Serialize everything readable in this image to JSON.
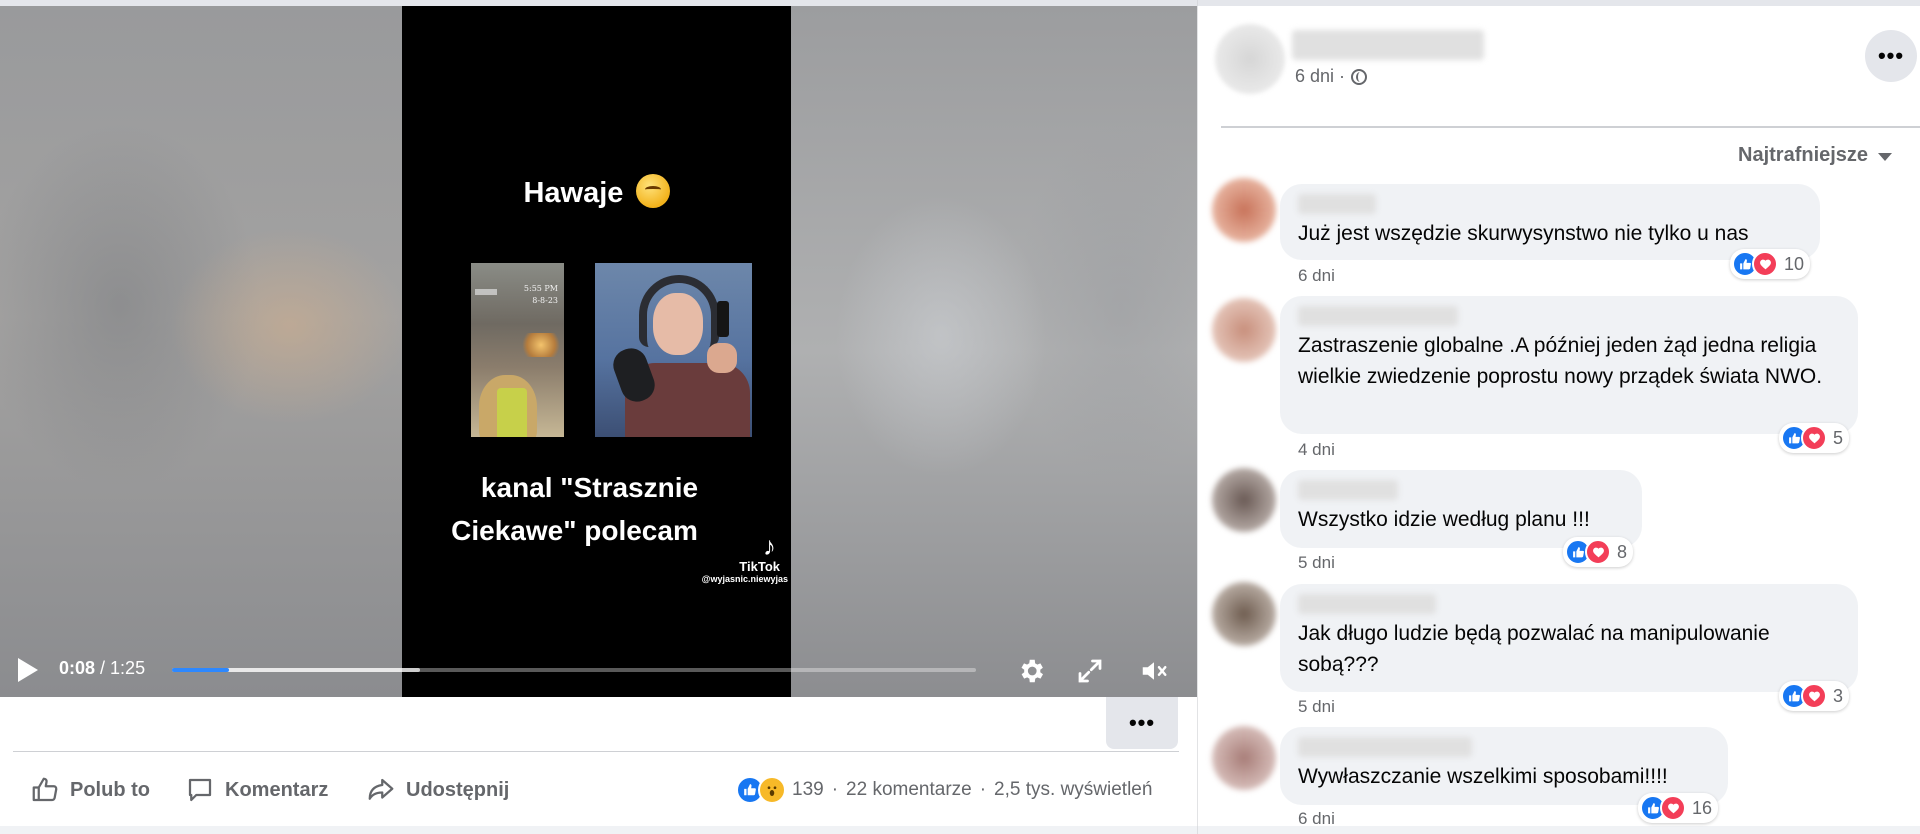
{
  "video": {
    "title": "Hawaje",
    "caption_line1": "kanal \"Strasznie",
    "caption_line2": "Ciekawe\" polecam",
    "tiktok_brand": "TikTok",
    "tiktok_handle": "@wyjasnic.niewyjas",
    "thumb_text_line1": "5:55 PM",
    "thumb_text_line2": "8-8-23",
    "time_current": "0:08",
    "time_separator": " / ",
    "time_total": "1:25",
    "progress_fraction": 0.071,
    "buffered_fraction": 0.309
  },
  "actions": {
    "like": "Polub to",
    "comment": "Komentarz",
    "share": "Udostępnij"
  },
  "stats": {
    "reactions_count": "139",
    "comments": "22 komentarze",
    "views": "2,5 tys. wyświetleń",
    "separator": "·"
  },
  "post": {
    "time": "6 dni ·"
  },
  "sort_label": "Najtrafniejsze",
  "comments": [
    {
      "text": "Już jest wszędzie skurwysynstwo nie tylko u nas",
      "reactions": "10",
      "time": "6 dni"
    },
    {
      "text": "Zastraszenie globalne .A później jeden żąd jedna religia wielkie zwiedzenie poprostu nowy prządek świata NWO.",
      "reactions": "5",
      "time": "4 dni"
    },
    {
      "text": "Wszystko idzie według planu !!!",
      "reactions": "8",
      "time": "5 dni"
    },
    {
      "text": "Jak długo ludzie będą pozwalać na manipulowanie sobą???",
      "reactions": "3",
      "time": "5 dni"
    },
    {
      "text": "Wywłaszczanie wszelkimi sposobami!!!!",
      "reactions": "16",
      "time": "6 dni"
    }
  ],
  "colors": {
    "like_blue": "#1877f2",
    "love_red": "#f33e58",
    "wow_yellow": "#f7b928",
    "progress_blue": "#2d88ff"
  }
}
